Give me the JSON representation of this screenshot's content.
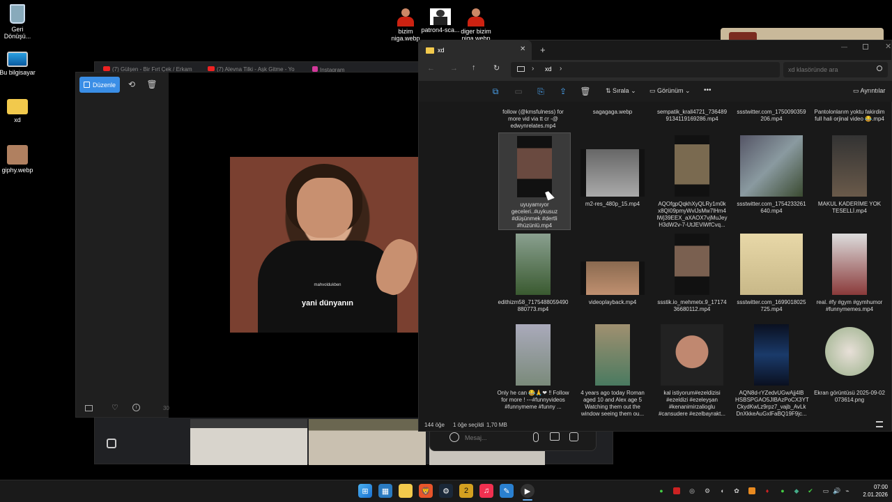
{
  "desktop": {
    "icons": [
      {
        "label": "Geri\nDönüşü...",
        "name": "recycle-bin"
      },
      {
        "label": "Bu bilgisayar",
        "name": "this-pc"
      },
      {
        "label": "xd",
        "name": "xd-folder"
      },
      {
        "label": "giphy.webp",
        "name": "giphy-file"
      }
    ],
    "top_icons": [
      {
        "label": "bizim\nniga.webp"
      },
      {
        "label": "patron4-sca..."
      },
      {
        "label": "diger bizim\nniga.webp"
      }
    ]
  },
  "browser_tabs": [
    "(7) Gülşen - Bir Fırt Çek / Erkam",
    "(7) Alevna Tilki - Aşk Gitme - Yo",
    "Instagram"
  ],
  "photo_viewer": {
    "edit_label": "Düzenle",
    "caption": "yani dünyanın",
    "watermark": "mahvoldukben",
    "bottom_num": "30"
  },
  "explorer": {
    "tab_title": "xd",
    "breadcrumb": "xd",
    "search_placeholder": "xd klasöründe ara",
    "toolbar": {
      "sort": "Sırala",
      "view": "Görünüm",
      "details": "Ayrıntılar",
      "more": "•••"
    },
    "row0": [
      "follow (@kmsfulness) for more  vid via tt cr -@ edwynrelates.mp4",
      "sagagaga.webp",
      "sempatik_krall4721_736489 9134119169286.mp4",
      "ssstwitter.com_1750090359 206.mp4",
      "Pantolonlarım yoktu fakirdim full hali orjinal video 😂.mp4"
    ],
    "row1": [
      "uyuyamıyor geceleri..#uykusuz #düşünmek #dertli #hüzünlü.mp4",
      "m2-res_480p_15.mp4",
      "AQOfgpQqkhXyQLRy1m0k x8QI09pmyWvlJsMw7lHm4 lWj39EEX_aXAOX7vjMuJey H3dW2v-7-UtJEViWfCvq...",
      "ssstwitter.com_1754233261 640.mp4",
      "MAKUL KADERİME YOK TESELLİ.mp4"
    ],
    "row2": [
      "edithizm58_7175488059490 880773.mp4",
      "videoplayback.mp4",
      "ssstik.io_mehmetx.9_17174 36680112.mp4",
      "ssstwitter.com_1699018025 725.mp4",
      "real. #fy #gym #gymhumor #funnymemes.mp4"
    ],
    "row3": [
      "Only he can 😂🙏❤ ‼ Follow for more ! ---#funnyvideos #funnymeme #funny ...",
      "4 years ago today Roman aged 10 and Alex age 5 Watching them out the window seeing them ou...",
      "kal istiyorum#ezeldizisi #ezeldizi #ezeleyşan #kenanimirzalioglu #cansudere #ezelbayrakt...",
      "AQN8d-rYZedvUGwAjj4lB HSBSPGAO5JIBAzPoCX3YT CkydKwLz9rpz7_vajb_AvLk DnXkkeAuGxlFaBQ19F9jc...",
      "Ekran görüntüsü 2025-09-02 073614.png"
    ],
    "status": {
      "count": "144 öğe",
      "selected": "1 öğe seçildi",
      "size": "1,70 MB"
    }
  },
  "chat": {
    "placeholder": "Mesaj..."
  },
  "taskbar": {
    "time": "07:00",
    "date": "2.01.2026",
    "badge": "2"
  }
}
